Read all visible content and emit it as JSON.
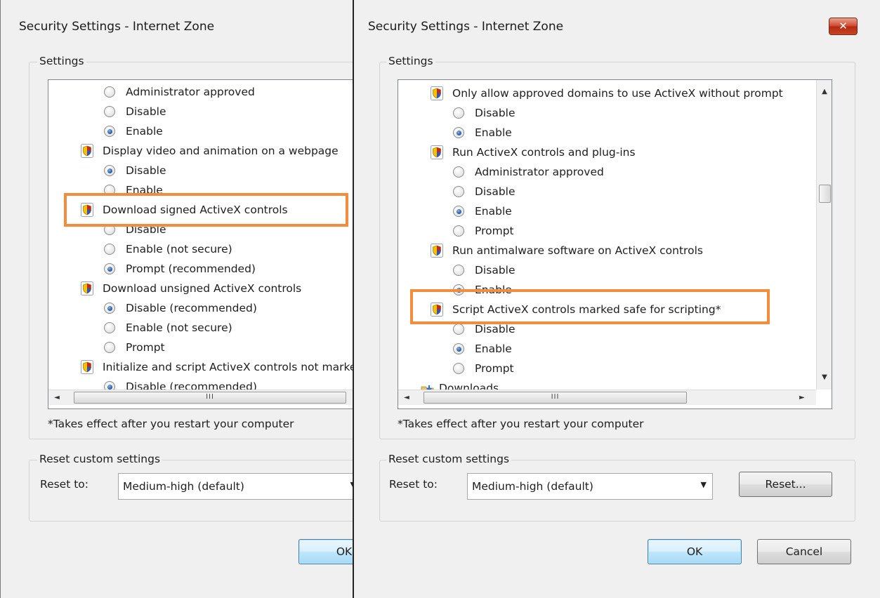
{
  "left_dialog": {
    "title": "Security Settings - Internet Zone",
    "settings_label": "Settings",
    "list_rows": [
      {
        "kind": "radio",
        "label": "Administrator approved",
        "checked": false
      },
      {
        "kind": "radio",
        "label": "Disable",
        "checked": false
      },
      {
        "kind": "radio",
        "label": "Enable",
        "checked": true
      },
      {
        "kind": "setting",
        "label": "Display video and animation on a webpage",
        "icon": "shield-icon"
      },
      {
        "kind": "radio",
        "label": "Disable",
        "checked": true
      },
      {
        "kind": "radio",
        "label": "Enable",
        "checked": false
      },
      {
        "kind": "setting",
        "label": "Download signed ActiveX controls",
        "icon": "shield-icon"
      },
      {
        "kind": "radio",
        "label": "Disable",
        "checked": false
      },
      {
        "kind": "radio",
        "label": "Enable (not secure)",
        "checked": false
      },
      {
        "kind": "radio",
        "label": "Prompt (recommended)",
        "checked": true
      },
      {
        "kind": "setting",
        "label": "Download unsigned ActiveX controls",
        "icon": "shield-icon"
      },
      {
        "kind": "radio",
        "label": "Disable (recommended)",
        "checked": true
      },
      {
        "kind": "radio",
        "label": "Enable (not secure)",
        "checked": false
      },
      {
        "kind": "radio",
        "label": "Prompt",
        "checked": false
      },
      {
        "kind": "setting",
        "label": "Initialize and script ActiveX controls not marked as safe",
        "icon": "shield-icon"
      },
      {
        "kind": "radio",
        "label": "Disable (recommended)",
        "checked": true
      }
    ],
    "hscroll_thumb_text": "III",
    "restart_note": "*Takes effect after you restart your computer",
    "reset_group_label": "Reset custom settings",
    "reset_to_label": "Reset to:",
    "reset_to_value": "Medium-high (default)",
    "ok_label": "OK",
    "highlighted_setting": "Download signed ActiveX controls"
  },
  "right_dialog": {
    "title": "Security Settings - Internet Zone",
    "close_glyph": "✕",
    "settings_label": "Settings",
    "list_rows": [
      {
        "kind": "setting",
        "label": "Only allow approved domains to use ActiveX without prompt",
        "icon": "shield-icon"
      },
      {
        "kind": "radio",
        "label": "Disable",
        "checked": false
      },
      {
        "kind": "radio",
        "label": "Enable",
        "checked": true
      },
      {
        "kind": "setting",
        "label": "Run ActiveX controls and plug-ins",
        "icon": "shield-icon"
      },
      {
        "kind": "radio",
        "label": "Administrator approved",
        "checked": false
      },
      {
        "kind": "radio",
        "label": "Disable",
        "checked": false
      },
      {
        "kind": "radio",
        "label": "Enable",
        "checked": true
      },
      {
        "kind": "radio",
        "label": "Prompt",
        "checked": false
      },
      {
        "kind": "setting",
        "label": "Run antimalware software on ActiveX controls",
        "icon": "shield-icon"
      },
      {
        "kind": "radio",
        "label": "Disable",
        "checked": false
      },
      {
        "kind": "radio",
        "label": "Enable",
        "checked": true
      },
      {
        "kind": "setting",
        "label": "Script ActiveX controls marked safe for scripting*",
        "icon": "shield-icon"
      },
      {
        "kind": "radio",
        "label": "Disable",
        "checked": false
      },
      {
        "kind": "radio",
        "label": "Enable",
        "checked": true
      },
      {
        "kind": "radio",
        "label": "Prompt",
        "checked": false
      },
      {
        "kind": "category",
        "label": "Downloads",
        "icon": "downloads-folder-icon"
      }
    ],
    "hscroll_thumb_text": "III",
    "restart_note": "*Takes effect after you restart your computer",
    "reset_group_label": "Reset custom settings",
    "reset_to_label": "Reset to:",
    "reset_to_value": "Medium-high (default)",
    "reset_button_label": "Reset...",
    "ok_label": "OK",
    "cancel_label": "Cancel",
    "highlighted_setting": "Script ActiveX controls marked safe for scripting*"
  },
  "colors": {
    "highlight": "#f18d3c",
    "dialog_bg": "#f0f0f0",
    "radio_checked": "#2a5ea8"
  }
}
